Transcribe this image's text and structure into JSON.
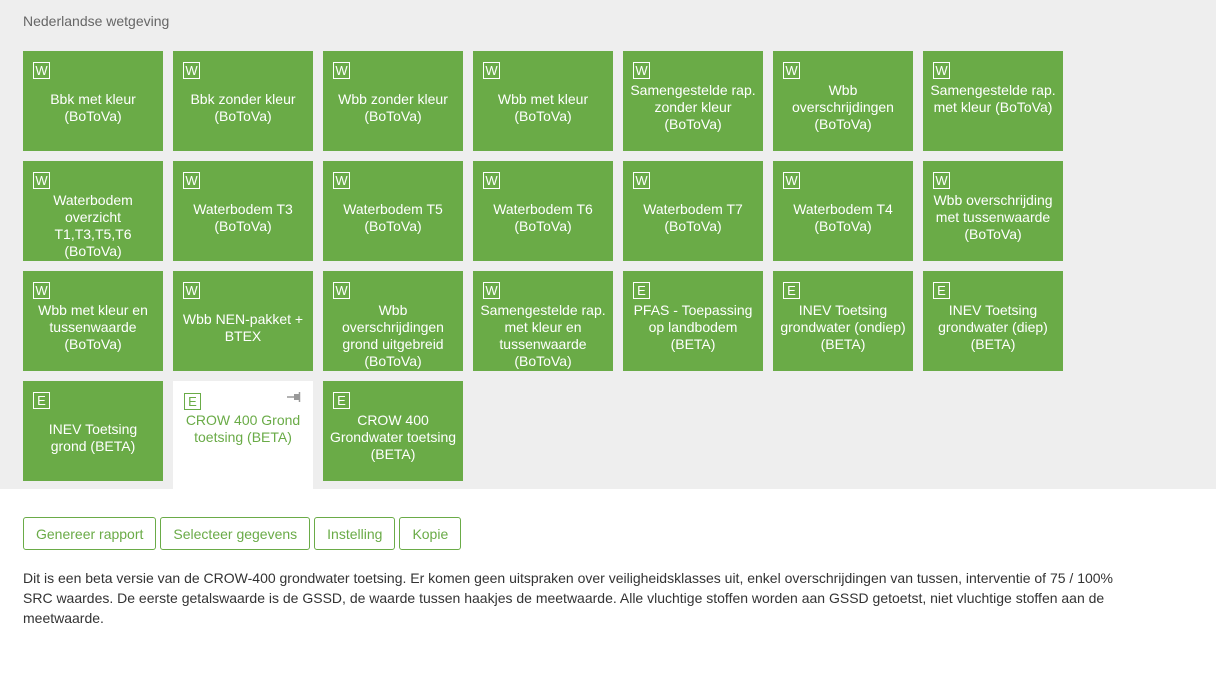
{
  "section": {
    "title": "Nederlandse wetgeving"
  },
  "tiles": [
    {
      "badge": "W",
      "label": "Bbk met kleur (BoToVa)"
    },
    {
      "badge": "W",
      "label": "Bbk zonder kleur (BoToVa)"
    },
    {
      "badge": "W",
      "label": "Wbb zonder kleur (BoToVa)"
    },
    {
      "badge": "W",
      "label": "Wbb met kleur (BoToVa)"
    },
    {
      "badge": "W",
      "label": "Samengestelde rap. zonder kleur (BoToVa)"
    },
    {
      "badge": "W",
      "label": "Wbb overschrijdingen (BoToVa)"
    },
    {
      "badge": "W",
      "label": "Samengestelde rap. met kleur (BoToVa)"
    },
    {
      "badge": "W",
      "label": "Waterbodem overzicht T1,T3,T5,T6 (BoToVa)"
    },
    {
      "badge": "W",
      "label": "Waterbodem T3 (BoToVa)"
    },
    {
      "badge": "W",
      "label": "Waterbodem T5 (BoToVa)"
    },
    {
      "badge": "W",
      "label": "Waterbodem T6 (BoToVa)"
    },
    {
      "badge": "W",
      "label": "Waterbodem T7 (BoToVa)"
    },
    {
      "badge": "W",
      "label": "Waterbodem T4 (BoToVa)"
    },
    {
      "badge": "W",
      "label": "Wbb overschrijding met tussenwaarde (BoToVa)"
    },
    {
      "badge": "W",
      "label": "Wbb met kleur en tussenwaarde (BoToVa)"
    },
    {
      "badge": "W",
      "label": "Wbb NEN-pakket + BTEX"
    },
    {
      "badge": "W",
      "label": "Wbb overschrijdingen grond uitgebreid (BoToVa)"
    },
    {
      "badge": "W",
      "label": "Samengestelde rap. met kleur en tussenwaarde (BoToVa)"
    },
    {
      "badge": "E",
      "label": "PFAS - Toepassing op landbodem (BETA)"
    },
    {
      "badge": "E",
      "label": "INEV Toetsing grondwater (ondiep) (BETA)"
    },
    {
      "badge": "E",
      "label": "INEV Toetsing grondwater (diep) (BETA)"
    },
    {
      "badge": "E",
      "label": "INEV Toetsing grond (BETA)"
    },
    {
      "badge": "E",
      "label": "CROW 400 Grond toetsing (BETA)",
      "selected": true
    },
    {
      "badge": "E",
      "label": "CROW 400 Grondwater toetsing (BETA)"
    }
  ],
  "actions": {
    "generate": "Genereer rapport",
    "select": "Selecteer gegevens",
    "settings": "Instelling",
    "copy": "Kopie"
  },
  "description": "Dit is een beta versie van de CROW-400 grondwater toetsing. Er komen geen uitspraken over veiligheidsklasses uit, enkel overschrijdingen van tussen, interventie of 75 / 100% SRC waardes. De eerste getalswaarde is de GSSD, de waarde tussen haakjes de meetwaarde. Alle vluchtige stoffen worden aan GSSD getoetst, niet vluchtige stoffen aan de meetwaarde.",
  "colors": {
    "tile": "#6aab47",
    "panel": "#eeeeee"
  },
  "icons": {
    "pin": "pin-icon"
  }
}
